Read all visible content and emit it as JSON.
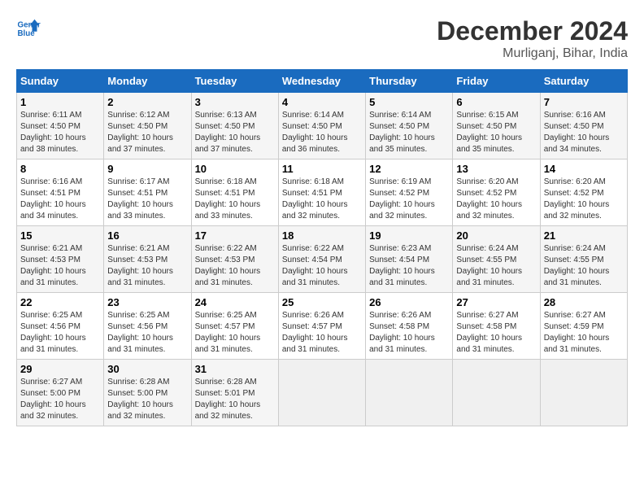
{
  "header": {
    "logo_line1": "General",
    "logo_line2": "Blue",
    "month_year": "December 2024",
    "location": "Murliganj, Bihar, India"
  },
  "weekdays": [
    "Sunday",
    "Monday",
    "Tuesday",
    "Wednesday",
    "Thursday",
    "Friday",
    "Saturday"
  ],
  "weeks": [
    [
      {
        "day": "1",
        "sunrise": "6:11 AM",
        "sunset": "4:50 PM",
        "daylight": "10 hours and 38 minutes."
      },
      {
        "day": "2",
        "sunrise": "6:12 AM",
        "sunset": "4:50 PM",
        "daylight": "10 hours and 37 minutes."
      },
      {
        "day": "3",
        "sunrise": "6:13 AM",
        "sunset": "4:50 PM",
        "daylight": "10 hours and 37 minutes."
      },
      {
        "day": "4",
        "sunrise": "6:14 AM",
        "sunset": "4:50 PM",
        "daylight": "10 hours and 36 minutes."
      },
      {
        "day": "5",
        "sunrise": "6:14 AM",
        "sunset": "4:50 PM",
        "daylight": "10 hours and 35 minutes."
      },
      {
        "day": "6",
        "sunrise": "6:15 AM",
        "sunset": "4:50 PM",
        "daylight": "10 hours and 35 minutes."
      },
      {
        "day": "7",
        "sunrise": "6:16 AM",
        "sunset": "4:50 PM",
        "daylight": "10 hours and 34 minutes."
      }
    ],
    [
      {
        "day": "8",
        "sunrise": "6:16 AM",
        "sunset": "4:51 PM",
        "daylight": "10 hours and 34 minutes."
      },
      {
        "day": "9",
        "sunrise": "6:17 AM",
        "sunset": "4:51 PM",
        "daylight": "10 hours and 33 minutes."
      },
      {
        "day": "10",
        "sunrise": "6:18 AM",
        "sunset": "4:51 PM",
        "daylight": "10 hours and 33 minutes."
      },
      {
        "day": "11",
        "sunrise": "6:18 AM",
        "sunset": "4:51 PM",
        "daylight": "10 hours and 32 minutes."
      },
      {
        "day": "12",
        "sunrise": "6:19 AM",
        "sunset": "4:52 PM",
        "daylight": "10 hours and 32 minutes."
      },
      {
        "day": "13",
        "sunrise": "6:20 AM",
        "sunset": "4:52 PM",
        "daylight": "10 hours and 32 minutes."
      },
      {
        "day": "14",
        "sunrise": "6:20 AM",
        "sunset": "4:52 PM",
        "daylight": "10 hours and 32 minutes."
      }
    ],
    [
      {
        "day": "15",
        "sunrise": "6:21 AM",
        "sunset": "4:53 PM",
        "daylight": "10 hours and 31 minutes."
      },
      {
        "day": "16",
        "sunrise": "6:21 AM",
        "sunset": "4:53 PM",
        "daylight": "10 hours and 31 minutes."
      },
      {
        "day": "17",
        "sunrise": "6:22 AM",
        "sunset": "4:53 PM",
        "daylight": "10 hours and 31 minutes."
      },
      {
        "day": "18",
        "sunrise": "6:22 AM",
        "sunset": "4:54 PM",
        "daylight": "10 hours and 31 minutes."
      },
      {
        "day": "19",
        "sunrise": "6:23 AM",
        "sunset": "4:54 PM",
        "daylight": "10 hours and 31 minutes."
      },
      {
        "day": "20",
        "sunrise": "6:24 AM",
        "sunset": "4:55 PM",
        "daylight": "10 hours and 31 minutes."
      },
      {
        "day": "21",
        "sunrise": "6:24 AM",
        "sunset": "4:55 PM",
        "daylight": "10 hours and 31 minutes."
      }
    ],
    [
      {
        "day": "22",
        "sunrise": "6:25 AM",
        "sunset": "4:56 PM",
        "daylight": "10 hours and 31 minutes."
      },
      {
        "day": "23",
        "sunrise": "6:25 AM",
        "sunset": "4:56 PM",
        "daylight": "10 hours and 31 minutes."
      },
      {
        "day": "24",
        "sunrise": "6:25 AM",
        "sunset": "4:57 PM",
        "daylight": "10 hours and 31 minutes."
      },
      {
        "day": "25",
        "sunrise": "6:26 AM",
        "sunset": "4:57 PM",
        "daylight": "10 hours and 31 minutes."
      },
      {
        "day": "26",
        "sunrise": "6:26 AM",
        "sunset": "4:58 PM",
        "daylight": "10 hours and 31 minutes."
      },
      {
        "day": "27",
        "sunrise": "6:27 AM",
        "sunset": "4:58 PM",
        "daylight": "10 hours and 31 minutes."
      },
      {
        "day": "28",
        "sunrise": "6:27 AM",
        "sunset": "4:59 PM",
        "daylight": "10 hours and 31 minutes."
      }
    ],
    [
      {
        "day": "29",
        "sunrise": "6:27 AM",
        "sunset": "5:00 PM",
        "daylight": "10 hours and 32 minutes."
      },
      {
        "day": "30",
        "sunrise": "6:28 AM",
        "sunset": "5:00 PM",
        "daylight": "10 hours and 32 minutes."
      },
      {
        "day": "31",
        "sunrise": "6:28 AM",
        "sunset": "5:01 PM",
        "daylight": "10 hours and 32 minutes."
      },
      null,
      null,
      null,
      null
    ]
  ]
}
